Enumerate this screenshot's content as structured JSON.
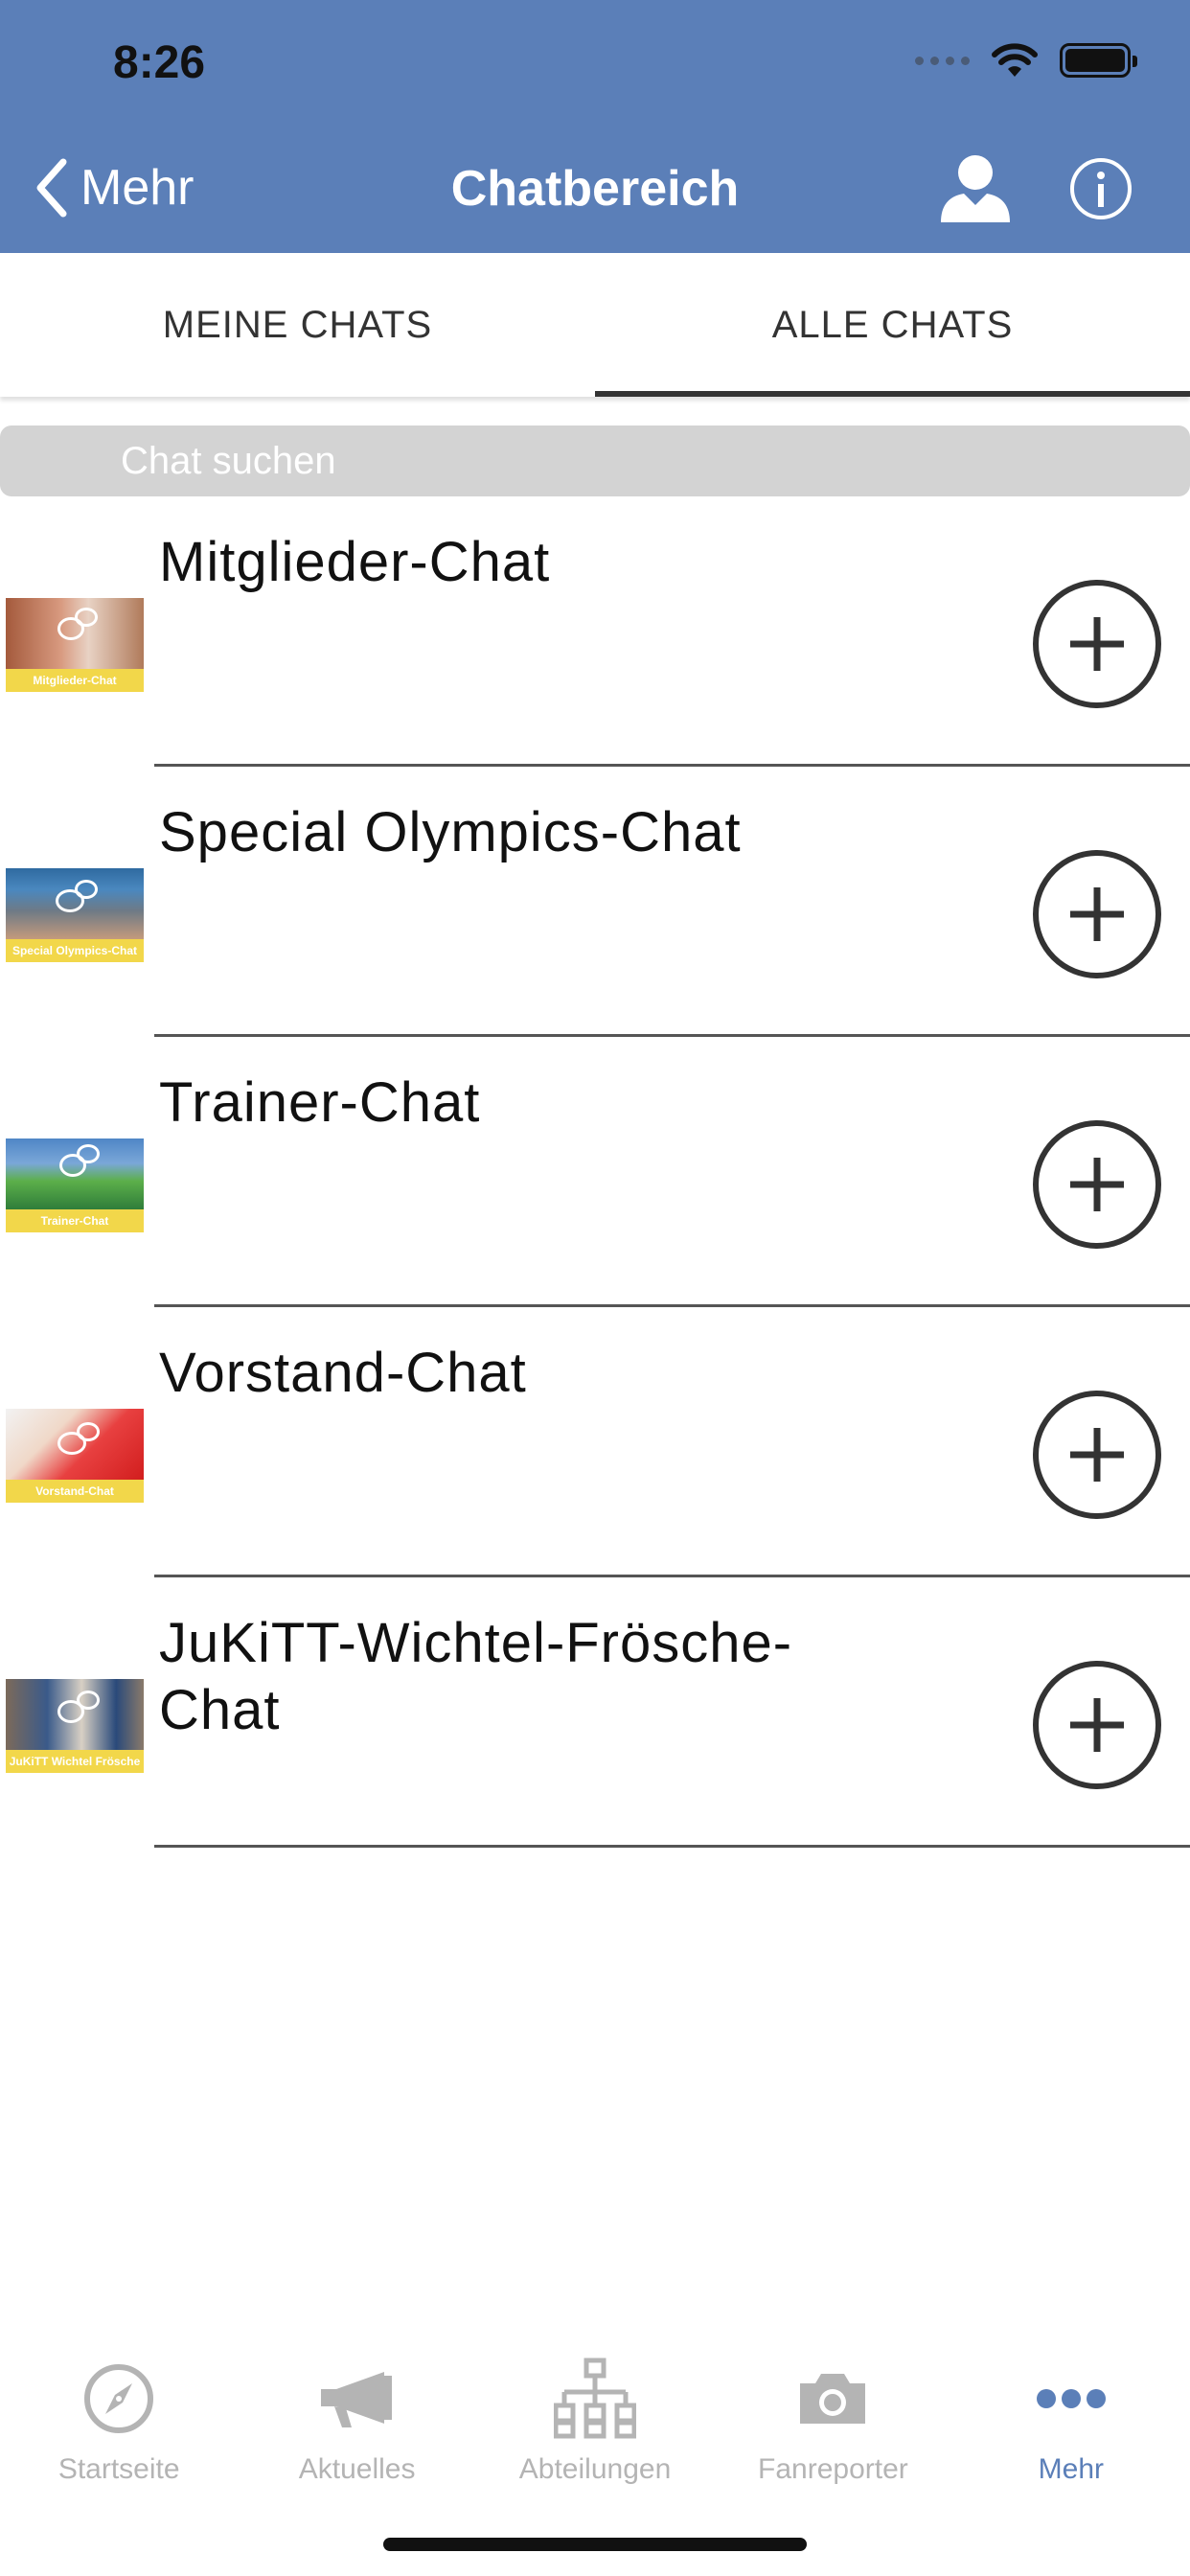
{
  "status_bar": {
    "time": "8:26"
  },
  "nav": {
    "back_label": "Mehr",
    "title": "Chatbereich",
    "colors": {
      "bar": "#5b7fb8",
      "text": "#ffffff"
    }
  },
  "tabs": [
    {
      "label": "MEINE CHATS",
      "active": false
    },
    {
      "label": "ALLE CHATS",
      "active": true
    }
  ],
  "search": {
    "placeholder": "Chat suchen",
    "value": ""
  },
  "chats": [
    {
      "name": "Mitglieder-Chat",
      "thumb_caption": "Mitglieder-Chat",
      "action_icon": "plus-circle-icon"
    },
    {
      "name": "Special Olympics-Chat",
      "thumb_caption": "Special Olympics-Chat",
      "action_icon": "plus-circle-icon"
    },
    {
      "name": "Trainer-Chat",
      "thumb_caption": "Trainer-Chat",
      "action_icon": "plus-circle-icon"
    },
    {
      "name": "Vorstand-Chat",
      "thumb_caption": "Vorstand-Chat",
      "action_icon": "plus-circle-icon"
    },
    {
      "name": "JuKiTT-Wichtel-Frösche-Chat",
      "thumb_caption": "JuKiTT Wichtel Frösche",
      "action_icon": "plus-circle-icon"
    }
  ],
  "tabbar": {
    "items": [
      {
        "label": "Startseite",
        "icon": "compass-icon",
        "active": false
      },
      {
        "label": "Aktuelles",
        "icon": "megaphone-icon",
        "active": false
      },
      {
        "label": "Abteilungen",
        "icon": "org-chart-icon",
        "active": false
      },
      {
        "label": "Fanreporter",
        "icon": "camera-icon",
        "active": false
      },
      {
        "label": "Mehr",
        "icon": "more-dots-icon",
        "active": true
      }
    ],
    "colors": {
      "active": "#5b7fb8",
      "inactive": "#b4b4b4"
    }
  }
}
